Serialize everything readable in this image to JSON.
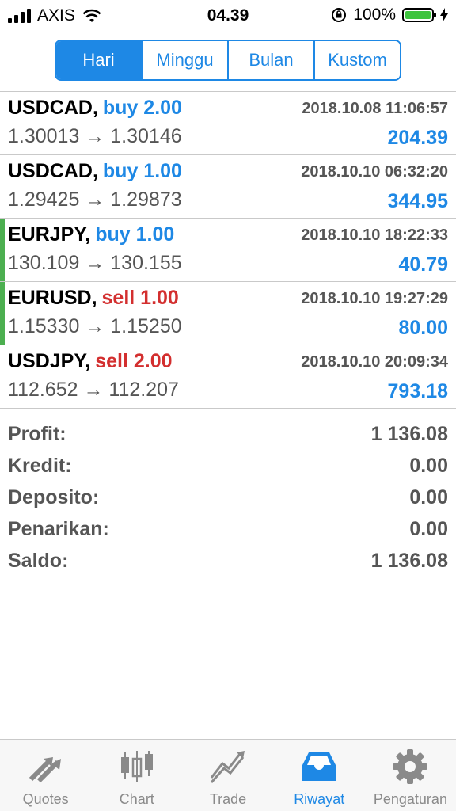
{
  "status_bar": {
    "carrier": "AXIS",
    "time": "04.39",
    "battery_percent": "100%",
    "battery_level": 1.0
  },
  "period_tabs": [
    {
      "label": "Hari",
      "active": true
    },
    {
      "label": "Minggu",
      "active": false
    },
    {
      "label": "Bulan",
      "active": false
    },
    {
      "label": "Kustom",
      "active": false
    }
  ],
  "trades": [
    {
      "symbol": "USDCAD,",
      "direction": "buy 2.00",
      "type": "buy",
      "datetime": "2018.10.08 11:06:57",
      "prices": "1.30013 → 1.30146",
      "profit": "204.39",
      "marker": false
    },
    {
      "symbol": "USDCAD,",
      "direction": "buy 1.00",
      "type": "buy",
      "datetime": "2018.10.10 06:32:20",
      "prices": "1.29425 → 1.29873",
      "profit": "344.95",
      "marker": false
    },
    {
      "symbol": "EURJPY,",
      "direction": "buy 1.00",
      "type": "buy",
      "datetime": "2018.10.10 18:22:33",
      "prices": "130.109 → 130.155",
      "profit": "40.79",
      "marker": true
    },
    {
      "symbol": "EURUSD,",
      "direction": "sell 1.00",
      "type": "sell",
      "datetime": "2018.10.10 19:27:29",
      "prices": "1.15330 → 1.15250",
      "profit": "80.00",
      "marker": true
    },
    {
      "symbol": "USDJPY,",
      "direction": "sell 2.00",
      "type": "sell",
      "datetime": "2018.10.10 20:09:34",
      "prices": "112.652 → 112.207",
      "profit": "793.18",
      "marker": false
    }
  ],
  "summary": [
    {
      "label": "Profit:",
      "value": "1 136.08"
    },
    {
      "label": "Kredit:",
      "value": "0.00"
    },
    {
      "label": "Deposito:",
      "value": "0.00"
    },
    {
      "label": "Penarikan:",
      "value": "0.00"
    },
    {
      "label": "Saldo:",
      "value": "1 136.08"
    }
  ],
  "tabbar": [
    {
      "label": "Quotes",
      "icon": "quotes-arrows-icon",
      "active": false
    },
    {
      "label": "Chart",
      "icon": "candlestick-chart-icon",
      "active": false
    },
    {
      "label": "Trade",
      "icon": "trade-trend-icon",
      "active": false
    },
    {
      "label": "Riwayat",
      "icon": "history-inbox-icon",
      "active": true
    },
    {
      "label": "Pengaturan",
      "icon": "gear-icon",
      "active": false
    }
  ],
  "colors": {
    "accent": "#1e88e5",
    "sell": "#d32f2f",
    "marker": "#4caf50",
    "battery": "#3ec43e"
  }
}
